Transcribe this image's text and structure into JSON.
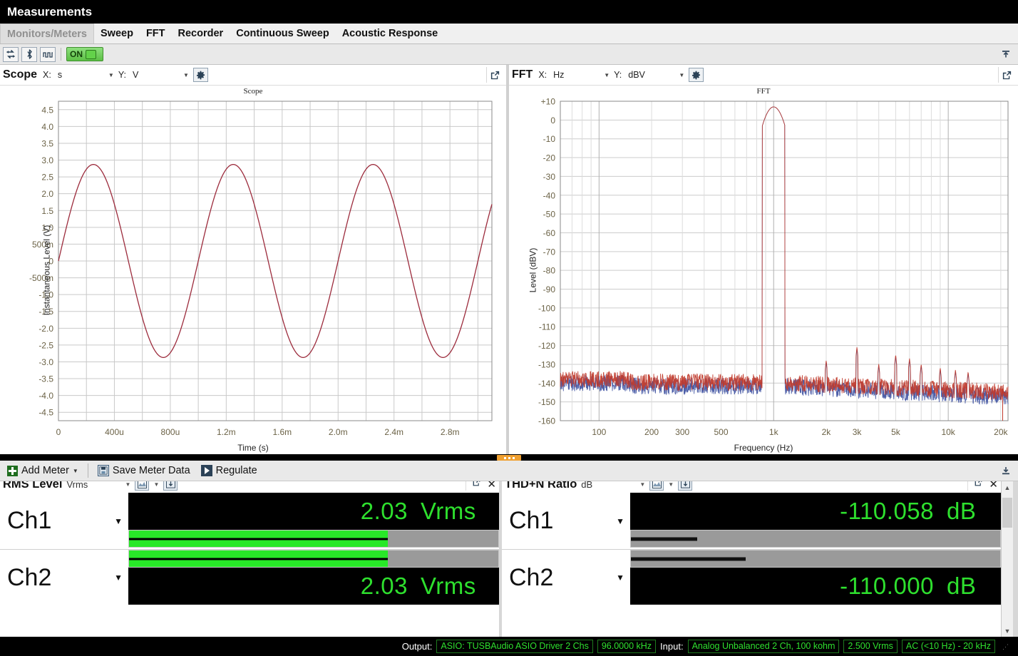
{
  "window": {
    "title": "Measurements"
  },
  "tabs": [
    {
      "label": "Monitors/Meters",
      "active": true
    },
    {
      "label": "Sweep",
      "active": false
    },
    {
      "label": "FFT",
      "active": false
    },
    {
      "label": "Recorder",
      "active": false
    },
    {
      "label": "Continuous Sweep",
      "active": false
    },
    {
      "label": "Acoustic Response",
      "active": false
    }
  ],
  "toolbar": {
    "icons": [
      "loopback-icon",
      "bluetooth-icon",
      "waveform-icon"
    ],
    "on_label": "ON",
    "collapse_label": "collapse-panel-icon"
  },
  "scope_panel": {
    "title": "Scope",
    "x_label": "X:",
    "x_value": "s",
    "y_label": "Y:",
    "y_value": "V",
    "gear": "settings-gear-icon",
    "popout": "popout-icon"
  },
  "fft_panel": {
    "title": "FFT",
    "x_label": "X:",
    "x_value": "Hz",
    "y_label": "Y:",
    "y_value": "dBV",
    "gear": "settings-gear-icon",
    "popout": "popout-icon"
  },
  "meter_toolbar": {
    "add_meter": "Add Meter",
    "save_meter_data": "Save Meter Data",
    "regulate": "Regulate"
  },
  "rms_meter": {
    "title": "RMS Level",
    "unit_select": "Vrms",
    "channels": [
      {
        "name": "Ch1",
        "value": "2.03",
        "unit": "Vrms",
        "bar_pct": 70
      },
      {
        "name": "Ch2",
        "value": "2.03",
        "unit": "Vrms",
        "bar_pct": 70
      }
    ]
  },
  "thdn_meter": {
    "title": "THD+N Ratio",
    "unit_select": "dB",
    "channels": [
      {
        "name": "Ch1",
        "value": "-110.058",
        "unit": "dB",
        "bar_pct": 18
      },
      {
        "name": "Ch2",
        "value": "-110.000",
        "unit": "dB",
        "bar_pct": 31
      }
    ]
  },
  "statusbar": {
    "output_label": "Output:",
    "output_device": "ASIO: TUSBAudio ASIO Driver 2 Chs",
    "output_rate": "96.0000 kHz",
    "input_label": "Input:",
    "input_device": "Analog Unbalanced 2 Ch, 100 kohm",
    "input_range": "2.500 Vrms",
    "input_coupling": "AC (<10 Hz) - 20 kHz"
  },
  "colors": {
    "accent_green": "#2ee02e",
    "trace_ch1": "#9c2b3c",
    "trace_ch2": "#3b4fa0",
    "splitter_handle": "#f0a030",
    "tab_active_bg": "#dedede"
  },
  "chart_data": [
    {
      "type": "line",
      "name": "scope",
      "title": "Scope",
      "xlabel": "Time (s)",
      "ylabel": "Instantaneous Level (V)",
      "xlim": [
        0,
        0.0031
      ],
      "ylim": [
        -4.75,
        4.75
      ],
      "grid": true,
      "xticks": [
        0,
        0.0004,
        0.0008,
        0.0012,
        0.0016,
        0.002,
        0.0024,
        0.0028
      ],
      "xticklabels": [
        "0",
        "400u",
        "800u",
        "1.2m",
        "1.6m",
        "2.0m",
        "2.4m",
        "2.8m"
      ],
      "yticks": [
        4.5,
        4.0,
        3.5,
        3.0,
        2.5,
        2.0,
        1.5,
        1.0,
        0.5,
        0,
        -0.5,
        -1.0,
        -1.5,
        -2.0,
        -2.5,
        -3.0,
        -3.5,
        -4.0,
        -4.5
      ],
      "yticklabels": [
        "4.5",
        "4.0",
        "3.5",
        "3.0",
        "2.5",
        "2.0",
        "1.5",
        "1.0",
        "500m",
        "0",
        "-500m",
        "-1.0",
        "-1.5",
        "-2.0",
        "-2.5",
        "-3.0",
        "-3.5",
        "-4.0",
        "-4.5"
      ],
      "series": [
        {
          "name": "Ch1",
          "color": "#9c2b3c",
          "waveform": "sine",
          "amplitude": 2.87,
          "frequency_hz": 1000,
          "phase_deg": 0
        }
      ]
    },
    {
      "type": "line",
      "name": "fft",
      "title": "FFT",
      "xlabel": "Frequency (Hz)",
      "ylabel": "Level (dBV)",
      "xscale": "log",
      "xlim": [
        60,
        22000
      ],
      "ylim": [
        -160,
        10
      ],
      "grid": true,
      "xticks": [
        100,
        200,
        300,
        500,
        1000,
        2000,
        3000,
        5000,
        10000,
        20000
      ],
      "xticklabels": [
        "100",
        "200",
        "300",
        "500",
        "1k",
        "2k",
        "3k",
        "5k",
        "10k",
        "20k"
      ],
      "yticks": [
        10,
        0,
        -10,
        -20,
        -30,
        -40,
        -50,
        -60,
        -70,
        -80,
        -90,
        -100,
        -110,
        -120,
        -130,
        -140,
        -150,
        -160
      ],
      "yticklabels": [
        "+10",
        "0",
        "-10",
        "-20",
        "-30",
        "-40",
        "-50",
        "-60",
        "-70",
        "-80",
        "-90",
        "-100",
        "-110",
        "-120",
        "-130",
        "-140",
        "-150",
        "-160"
      ],
      "noise_floor_dbv": -140,
      "fundamental": {
        "frequency_hz": 1000,
        "level_dbv": 7
      },
      "harmonics": [
        {
          "frequency_hz": 2000,
          "level_dbv": -128
        },
        {
          "frequency_hz": 3000,
          "level_dbv": -121
        },
        {
          "frequency_hz": 4000,
          "level_dbv": -130
        },
        {
          "frequency_hz": 5000,
          "level_dbv": -125
        },
        {
          "frequency_hz": 6000,
          "level_dbv": -127
        },
        {
          "frequency_hz": 7000,
          "level_dbv": -130
        },
        {
          "frequency_hz": 9000,
          "level_dbv": -132
        },
        {
          "frequency_hz": 11000,
          "level_dbv": -133
        },
        {
          "frequency_hz": 13000,
          "level_dbv": -134
        }
      ],
      "series": [
        {
          "name": "Ch1",
          "color": "#c0392b"
        },
        {
          "name": "Ch2",
          "color": "#3b4fa0"
        }
      ]
    }
  ]
}
